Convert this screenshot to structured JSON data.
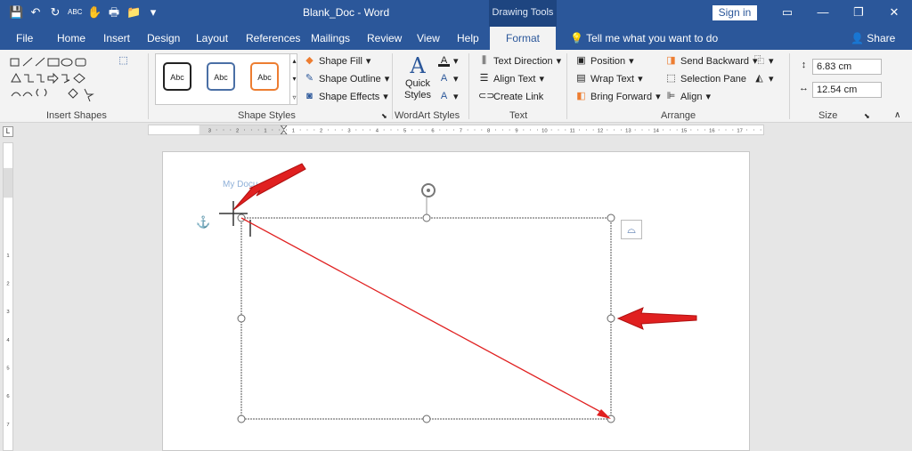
{
  "window": {
    "title": "Blank_Doc  -  Word",
    "context_tab": "Drawing Tools",
    "signin": "Sign in"
  },
  "qat": {
    "icons": [
      "save-icon",
      "undo-icon",
      "redo-icon",
      "spelling-icon",
      "touch-mode-icon",
      "print-preview-icon",
      "open-icon",
      "customize-icon"
    ],
    "glyphs": [
      "💾",
      "↶",
      "↻",
      "ABC",
      "✋",
      "🖶",
      "📁",
      "▾"
    ]
  },
  "tabs": [
    "File",
    "Home",
    "Insert",
    "Design",
    "Layout",
    "References",
    "Mailings",
    "Review",
    "View",
    "Help",
    "Format"
  ],
  "tell_me": "Tell me what you want to do",
  "share": "Share",
  "ribbon": {
    "insert_shapes": {
      "label": "Insert Shapes"
    },
    "shape_styles": {
      "label": "Shape Styles",
      "samples": [
        "Abc",
        "Abc",
        "Abc"
      ],
      "sample_colors": [
        "#222222",
        "#4a6fa5",
        "#ed7d31"
      ],
      "fill": "Shape Fill",
      "outline": "Shape Outline",
      "effects": "Shape Effects"
    },
    "wordart": {
      "label": "WordArt Styles",
      "quick_styles": "Quick Styles"
    },
    "text": {
      "label": "Text",
      "direction": "Text Direction",
      "align": "Align Text",
      "link": "Create Link"
    },
    "arrange": {
      "label": "Arrange",
      "position": "Position",
      "wrap": "Wrap Text",
      "forward": "Bring Forward",
      "backward": "Send Backward",
      "selection": "Selection Pane",
      "align": "Align"
    },
    "size": {
      "label": "Size",
      "height": "6.83 cm",
      "width": "12.54 cm"
    }
  },
  "ruler": {
    "h_labels": [
      "3",
      "2",
      "1",
      "1",
      "2",
      "3",
      "4",
      "5",
      "6",
      "7",
      "8",
      "9",
      "10",
      "11",
      "12",
      "13",
      "14",
      "15",
      "16",
      "17"
    ],
    "v_labels": [
      "1",
      "2",
      "3",
      "4",
      "5",
      "6",
      "7"
    ],
    "corner": "L"
  },
  "document": {
    "watermark": "My Docu"
  },
  "colors": {
    "accent": "#2b579a",
    "arrow": "#e02020"
  }
}
